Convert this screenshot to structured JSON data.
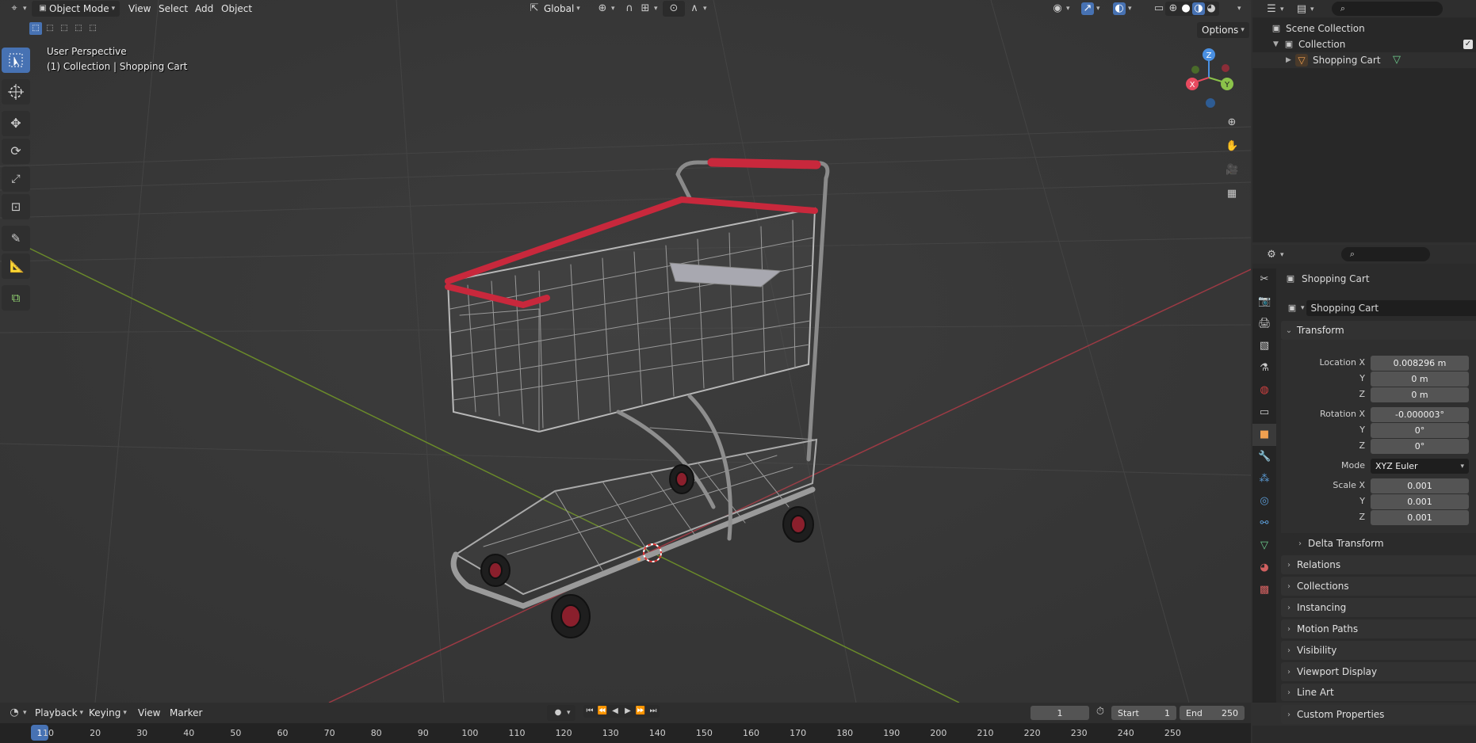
{
  "header": {
    "mode": "Object Mode",
    "menus": [
      "View",
      "Select",
      "Add",
      "Object"
    ],
    "orientation": "Global",
    "options_label": "Options"
  },
  "viewport": {
    "view_name": "User Perspective",
    "object_info": "(1) Collection | Shopping Cart",
    "gizmo": {
      "x": "X",
      "y": "Y",
      "z": "Z"
    }
  },
  "outliner": {
    "search_placeholder": "",
    "scene_collection": "Scene Collection",
    "collection": "Collection",
    "object": "Shopping Cart"
  },
  "properties": {
    "search_placeholder": "",
    "context_name": "Shopping Cart",
    "object_name": "Shopping Cart",
    "transform_title": "Transform",
    "location_label": "Location X",
    "location": {
      "x": "0.008296 m",
      "y": "0 m",
      "z": "0 m"
    },
    "rotation_label": "Rotation X",
    "rotation": {
      "x": "-0.000003°",
      "y": "0°",
      "z": "0°"
    },
    "mode_label": "Mode",
    "mode_value": "XYZ Euler",
    "scale_label": "Scale X",
    "scale": {
      "x": "0.001",
      "y": "0.001",
      "z": "0.001"
    },
    "y_label": "Y",
    "z_label": "Z",
    "delta_transform": "Delta Transform",
    "panels": [
      "Relations",
      "Collections",
      "Instancing",
      "Motion Paths",
      "Visibility",
      "Viewport Display",
      "Line Art",
      "Custom Properties"
    ]
  },
  "timeline": {
    "menus": [
      "Playback",
      "Keying",
      "View",
      "Marker"
    ],
    "current_frame": "1",
    "start_label": "Start",
    "start_value": "1",
    "end_label": "End",
    "end_value": "250",
    "ticks": [
      "1",
      "10",
      "20",
      "30",
      "40",
      "50",
      "60",
      "70",
      "80",
      "90",
      "100",
      "110",
      "120",
      "130",
      "140",
      "150",
      "160",
      "170",
      "180",
      "190",
      "200",
      "210",
      "220",
      "230",
      "240",
      "250"
    ]
  },
  "colors": {
    "accent": "#4772b3",
    "cart_red": "#c8283c",
    "axis_x": "#e84a5f",
    "axis_y": "#8bc34a",
    "axis_z": "#4a90e2"
  }
}
